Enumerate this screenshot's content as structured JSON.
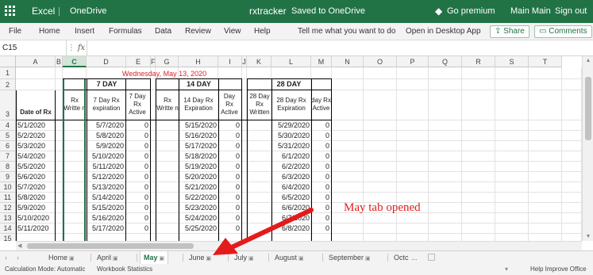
{
  "titlebar": {
    "app_name": "Excel",
    "location": "OneDrive",
    "doc_name": "rxtracker",
    "save_dash": "-",
    "save_status": "Saved to OneDrive",
    "premium_icon": "◆",
    "premium": "Go premium",
    "user_name": "Main Main",
    "sign_out": "Sign out",
    "bg_color": "#217346"
  },
  "menu": {
    "file": "File",
    "home": "Home",
    "insert": "Insert",
    "formulas": "Formulas",
    "data": "Data",
    "review": "Review",
    "view": "View",
    "help": "Help",
    "tell_me": "Tell me what you want to do",
    "open_desktop": "Open in Desktop App",
    "share": "Share",
    "comments": "Comments"
  },
  "formula_bar": {
    "name_box": "C15",
    "dots": "⋮",
    "fx": "fx",
    "value": ""
  },
  "grid": {
    "columns": [
      "A",
      "B",
      "C",
      "D",
      "E",
      "F",
      "G",
      "H",
      "I",
      "J",
      "K",
      "L",
      "M",
      "N",
      "O",
      "P",
      "Q",
      "R",
      "S",
      "T"
    ],
    "selected_column": "C",
    "rows": [
      "1",
      "2",
      "3",
      "4",
      "5",
      "6",
      "7",
      "8",
      "9",
      "10",
      "11",
      "12",
      "13",
      "14",
      "15"
    ],
    "banner_date": "Wednesday, May 13, 2020",
    "groups": {
      "g7": "7 DAY",
      "g14": "14 DAY",
      "g28": "28 DAY"
    },
    "headers": {
      "date_of_rx": "Date of Rx",
      "c": "Rx Writte n",
      "d": "7 Day Rx expiration",
      "e": "7 Day Rx Active",
      "g": "Rx Writte n",
      "h": "14 Day Rx Expiration",
      "i": "Day Rx Active",
      "k": "28 Day Rx Written",
      "l": "28 Day Rx Expiration",
      "m": "day Rx Active"
    },
    "data_rows": [
      {
        "a": "5/1/2020",
        "d": "5/7/2020",
        "e": "0",
        "h": "5/15/2020",
        "i": "0",
        "l": "5/29/2020",
        "m": "0"
      },
      {
        "a": "5/2/2020",
        "d": "5/8/2020",
        "e": "0",
        "h": "5/16/2020",
        "i": "0",
        "l": "5/30/2020",
        "m": "0"
      },
      {
        "a": "5/3/2020",
        "d": "5/9/2020",
        "e": "0",
        "h": "5/17/2020",
        "i": "0",
        "l": "5/31/2020",
        "m": "0"
      },
      {
        "a": "5/4/2020",
        "d": "5/10/2020",
        "e": "0",
        "h": "5/18/2020",
        "i": "0",
        "l": "6/1/2020",
        "m": "0"
      },
      {
        "a": "5/5/2020",
        "d": "5/11/2020",
        "e": "0",
        "h": "5/19/2020",
        "i": "0",
        "l": "6/2/2020",
        "m": "0"
      },
      {
        "a": "5/6/2020",
        "d": "5/12/2020",
        "e": "0",
        "h": "5/20/2020",
        "i": "0",
        "l": "6/3/2020",
        "m": "0"
      },
      {
        "a": "5/7/2020",
        "d": "5/13/2020",
        "e": "0",
        "h": "5/21/2020",
        "i": "0",
        "l": "6/4/2020",
        "m": "0"
      },
      {
        "a": "5/8/2020",
        "d": "5/14/2020",
        "e": "0",
        "h": "5/22/2020",
        "i": "0",
        "l": "6/5/2020",
        "m": "0"
      },
      {
        "a": "5/9/2020",
        "d": "5/15/2020",
        "e": "0",
        "h": "5/23/2020",
        "i": "0",
        "l": "6/6/2020",
        "m": "0"
      },
      {
        "a": "5/10/2020",
        "d": "5/16/2020",
        "e": "0",
        "h": "5/24/2020",
        "i": "0",
        "l": "6/7/2020",
        "m": "0"
      },
      {
        "a": "5/11/2020",
        "d": "5/17/2020",
        "e": "0",
        "h": "5/25/2020",
        "i": "0",
        "l": "6/8/2020",
        "m": "0"
      }
    ]
  },
  "tabs": {
    "nav_prev": "‹",
    "nav_next": "›",
    "items": [
      {
        "label": "Home",
        "active": false
      },
      {
        "label": "April",
        "active": false
      },
      {
        "label": "May",
        "active": true
      },
      {
        "label": "June",
        "active": false
      },
      {
        "label": "July",
        "active": false
      },
      {
        "label": "August",
        "active": false
      },
      {
        "label": "September",
        "active": false
      },
      {
        "label": "Octc",
        "active": false
      }
    ],
    "more": "...",
    "lock_icon": "🔒"
  },
  "status": {
    "calc_mode": "Calculation Mode: Automatic",
    "workbook_stats": "Workbook Statistics",
    "caret": "▾",
    "help_improve": "Help Improve Office"
  },
  "annotation": {
    "text": "May tab opened",
    "color": "#e31b1b"
  }
}
